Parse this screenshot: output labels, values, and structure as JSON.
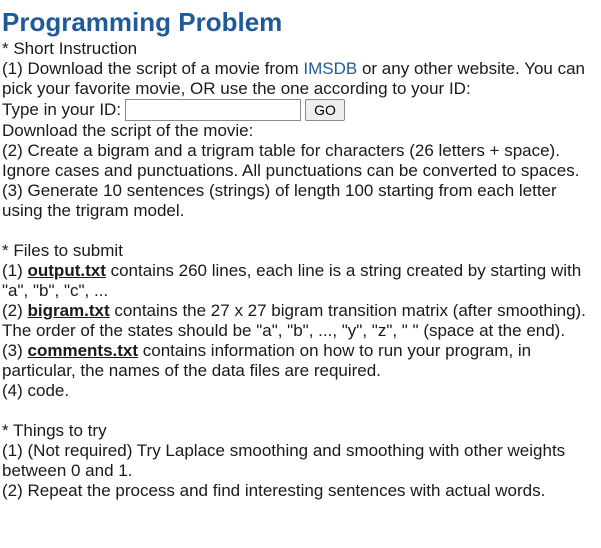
{
  "title": "Programming Problem",
  "short": {
    "heading": "* Short Instruction",
    "step1_before": "(1) Download the script of a movie from ",
    "step1_link": "IMSDB",
    "step1_after": " or any other website. You can pick your favorite movie, OR use the one according to your ID:",
    "id_label": "Type in your ID:",
    "id_value": "",
    "go_label": "GO",
    "download_line": "Download the script of the movie:",
    "step2": "(2) Create a bigram and a trigram table for characters (26 letters + space). Ignore cases and punctuations. All punctuations can be converted to spaces.",
    "step3": "(3) Generate 10 sentences (strings) of length 100 starting from each letter using the trigram model."
  },
  "files": {
    "heading": "* Files to submit",
    "f1_num": "(1) ",
    "f1_name": "output.txt",
    "f1_text": " contains 260 lines, each line is a string created by starting with \"a\", \"b\", \"c\", ...",
    "f2_num": "(2) ",
    "f2_name": "bigram.txt",
    "f2_text": " contains the 27 x 27 bigram transition matrix (after smoothing). The order of the states should be \"a\", \"b\", ..., \"y\", \"z\", \" \" (space at the end).",
    "f3_num": "(3) ",
    "f3_name": "comments.txt",
    "f3_text": " contains information on how to run your program, in particular, the names of the data files are required.",
    "f4": "(4) code."
  },
  "things": {
    "heading": "* Things to try",
    "t1": "(1) (Not required) Try Laplace smoothing and smoothing with other weights between 0 and 1.",
    "t2": "(2) Repeat the process and find interesting sentences with actual words."
  }
}
